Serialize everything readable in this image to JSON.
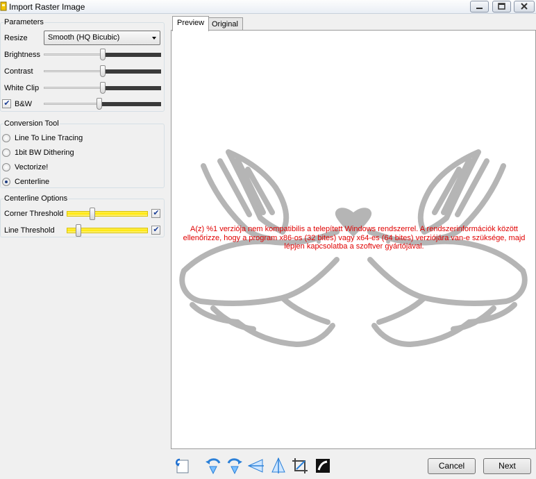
{
  "window": {
    "title": "Import Raster Image"
  },
  "parameters": {
    "title": "Parameters",
    "resize_label": "Resize",
    "resize_value": "Smooth (HQ Bicubic)",
    "brightness_label": "Brightness",
    "brightness_value": 0.5,
    "contrast_label": "Contrast",
    "contrast_value": 0.5,
    "whiteclip_label": "White Clip",
    "whiteclip_value": 0.5,
    "bw_label": "B&W",
    "bw_checked": true,
    "bw_value": 0.47
  },
  "conversion": {
    "title": "Conversion Tool",
    "options": [
      "Line To Line Tracing",
      "1bit BW Dithering",
      "Vectorize!",
      "Centerline"
    ],
    "selected": "Centerline"
  },
  "centerline": {
    "title": "Centerline Options",
    "corner_label": "Corner Threshold",
    "corner_value": 0.3,
    "corner_checked": true,
    "line_label": "Line Threshold",
    "line_value": 0.12,
    "line_checked": true
  },
  "tabs": [
    "Preview",
    "Original"
  ],
  "active_tab": "Preview",
  "error_message": "A(z) %1 verziója nem kompatibilis a telepített Windows rendszerrel. A rendszerinformációk között ellenőrizze, hogy a program x86-os (32 bites) vagy x64-es (64 bites) verziójára van-e szüksége, majd lépjen kapcsolatba a szoftver gyártójával.",
  "toolbar": {
    "icons": [
      "reset-icon",
      "rotate-left-icon",
      "rotate-right-icon",
      "flip-horizontal-icon",
      "flip-vertical-icon",
      "crop-icon",
      "invert-icon"
    ]
  },
  "buttons": {
    "cancel": "Cancel",
    "next": "Next"
  },
  "colors": {
    "accent_yellow": "#ffe600",
    "error_red": "#e00000",
    "dove_gray": "#b5b5b5"
  }
}
